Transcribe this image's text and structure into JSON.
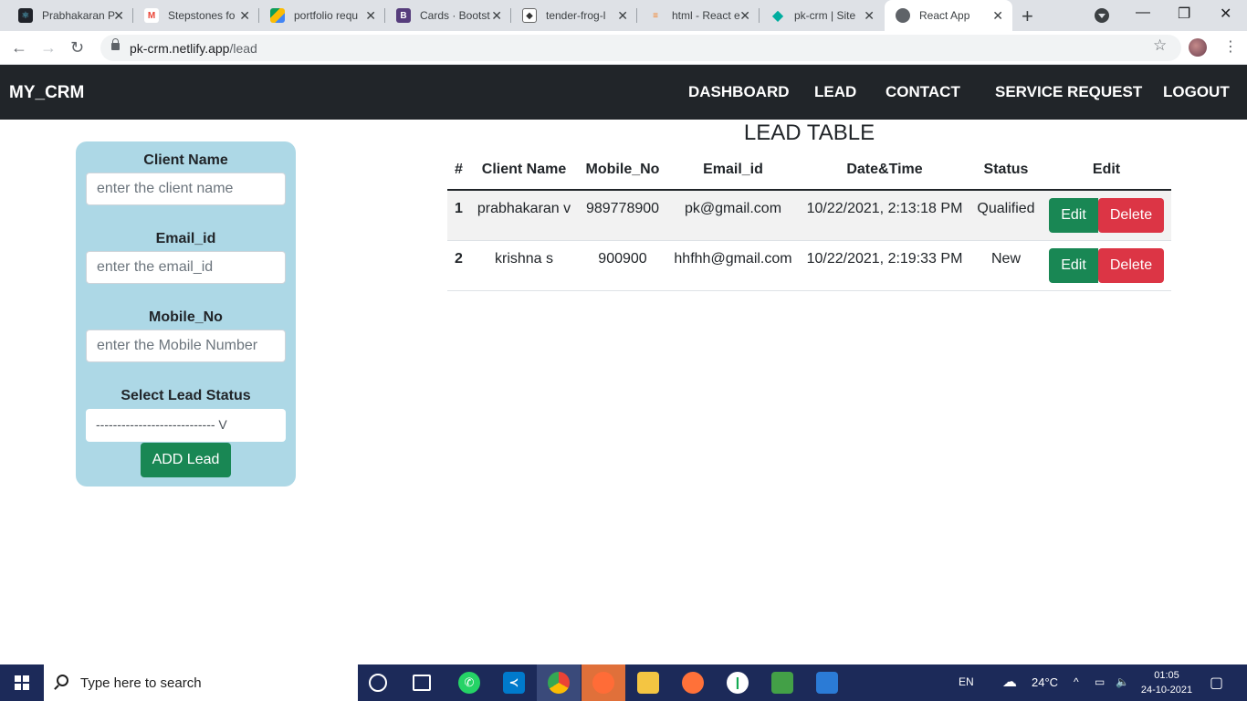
{
  "browser": {
    "tabs": [
      {
        "label": "Prabhakaran P",
        "icon": "react-icon"
      },
      {
        "label": "Stepstones fo",
        "icon": "gmail-icon"
      },
      {
        "label": "portfolio requ",
        "icon": "drive-icon"
      },
      {
        "label": "Cards · Bootst",
        "icon": "bootstrap-icon"
      },
      {
        "label": "tender-frog-l",
        "icon": "codesandbox-icon"
      },
      {
        "label": "html - React e",
        "icon": "stackoverflow-icon"
      },
      {
        "label": "pk-crm | Site",
        "icon": "netlify-icon"
      },
      {
        "label": "React App",
        "icon": "globe-icon"
      }
    ],
    "url_host": "pk-crm.netlify.app",
    "url_path": "/lead"
  },
  "navbar": {
    "brand": "MY_CRM",
    "links": [
      "DASHBOARD",
      "LEAD",
      "CONTACT",
      "SERVICE REQUEST",
      "LOGOUT"
    ]
  },
  "form": {
    "client_name_label": "Client Name",
    "client_name_placeholder": "enter the client name",
    "email_label": "Email_id",
    "email_placeholder": "enter the email_id",
    "mobile_label": "Mobile_No",
    "mobile_placeholder": "enter the Mobile Number",
    "status_label": "Select Lead Status",
    "status_selected": "---------------------------- V",
    "add_button": "ADD Lead"
  },
  "table": {
    "title": "LEAD TABLE",
    "headers": [
      "#",
      "Client Name",
      "Mobile_No",
      "Email_id",
      "Date&Time",
      "Status",
      "Edit"
    ],
    "rows": [
      {
        "num": "1",
        "name": "prabhakaran v",
        "mobile": "989778900",
        "email": "pk@gmail.com",
        "datetime": "10/22/2021, 2:13:18 PM",
        "status": "Qualified"
      },
      {
        "num": "2",
        "name": "krishna s",
        "mobile": "900900",
        "email": "hhfhh@gmail.com",
        "datetime": "10/22/2021, 2:19:33 PM",
        "status": "New"
      }
    ],
    "edit_label": "Edit",
    "delete_label": "Delete"
  },
  "taskbar": {
    "search_text": "Type here to search",
    "language": "EN",
    "temperature": "24°C",
    "time": "01:05",
    "date": "24-10-2021"
  },
  "colors": {
    "navbar_bg": "#212529",
    "form_bg": "#add8e6",
    "success": "#198754",
    "danger": "#dc3545"
  }
}
